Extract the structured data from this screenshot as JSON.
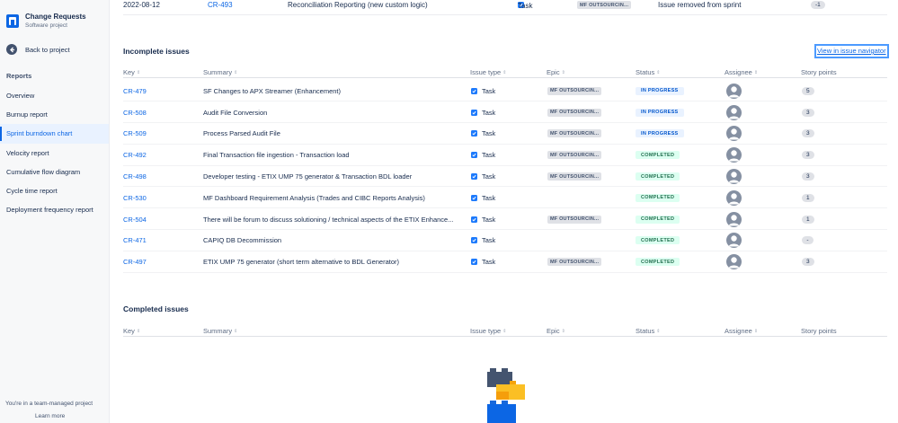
{
  "sidebar": {
    "project_name": "Change Requests",
    "project_type": "Software project",
    "back_label": "Back to project",
    "section_title": "Reports",
    "items": [
      {
        "label": "Overview",
        "active": false
      },
      {
        "label": "Burnup report",
        "active": false
      },
      {
        "label": "Sprint burndown chart",
        "active": true
      },
      {
        "label": "Velocity report",
        "active": false
      },
      {
        "label": "Cumulative flow diagram",
        "active": false
      },
      {
        "label": "Cycle time report",
        "active": false
      },
      {
        "label": "Deployment frequency report",
        "active": false
      }
    ],
    "footer_text": "You're in a team-managed project",
    "footer_link": "Learn more"
  },
  "top_row": {
    "date": "2022-08-12",
    "key": "CR-493",
    "summary": "Reconciliation Reporting (new custom logic)",
    "type": "Task",
    "epic": "MF OUTSOURCIN...",
    "status": "Issue removed from sprint",
    "points": "-1"
  },
  "incomplete": {
    "title": "Incomplete issues",
    "navigator_link": "View in issue navigator",
    "columns": {
      "key": "Key",
      "summary": "Summary",
      "type": "Issue type",
      "epic": "Epic",
      "status": "Status",
      "assignee": "Assignee",
      "points": "Story points"
    },
    "rows": [
      {
        "key": "CR-479",
        "summary": "SF Changes to APX Streamer (Enhancement)",
        "type": "Task",
        "epic": "MF OUTSOURCIN...",
        "status": "IN PROGRESS",
        "status_kind": "inprogress",
        "points": "5"
      },
      {
        "key": "CR-508",
        "summary": "Audit File Conversion",
        "type": "Task",
        "epic": "MF OUTSOURCIN...",
        "status": "IN PROGRESS",
        "status_kind": "inprogress",
        "points": "3"
      },
      {
        "key": "CR-509",
        "summary": "Process Parsed Audit File",
        "type": "Task",
        "epic": "MF OUTSOURCIN...",
        "status": "IN PROGRESS",
        "status_kind": "inprogress",
        "points": "3"
      },
      {
        "key": "CR-492",
        "summary": "Final Transaction file ingestion - Transaction load",
        "type": "Task",
        "epic": "MF OUTSOURCIN...",
        "status": "COMPLETED",
        "status_kind": "completed",
        "points": "3"
      },
      {
        "key": "CR-498",
        "summary": "Developer testing - ETIX UMP 75 generator & Transaction BDL loader",
        "type": "Task",
        "epic": "MF OUTSOURCIN...",
        "status": "COMPLETED",
        "status_kind": "completed",
        "points": "3"
      },
      {
        "key": "CR-530",
        "summary": "MF Dashboard Requirement Analysis (Trades and CIBC Reports Analysis)",
        "type": "Task",
        "epic": "",
        "status": "COMPLETED",
        "status_kind": "completed",
        "points": "1"
      },
      {
        "key": "CR-504",
        "summary": "There will be forum to discuss solutioning / technical aspects of the ETIX Enhance...",
        "type": "Task",
        "epic": "MF OUTSOURCIN...",
        "status": "COMPLETED",
        "status_kind": "completed",
        "points": "1"
      },
      {
        "key": "CR-471",
        "summary": "CAPIQ DB Decommission",
        "type": "Task",
        "epic": "",
        "status": "COMPLETED",
        "status_kind": "completed",
        "points": "-"
      },
      {
        "key": "CR-497",
        "summary": "ETIX UMP 75 generator (short term alternative to BDL Generator)",
        "type": "Task",
        "epic": "MF OUTSOURCIN...",
        "status": "COMPLETED",
        "status_kind": "completed",
        "points": "3"
      }
    ]
  },
  "completed": {
    "title": "Completed issues",
    "columns": {
      "key": "Key",
      "summary": "Summary",
      "type": "Issue type",
      "epic": "Epic",
      "status": "Status",
      "assignee": "Assignee",
      "points": "Story points"
    }
  },
  "colors": {
    "link": "#0c66e4",
    "inprogress_bg": "#e9f2ff",
    "completed_bg": "#dcfff1",
    "checkbox": "#1d7afc"
  }
}
